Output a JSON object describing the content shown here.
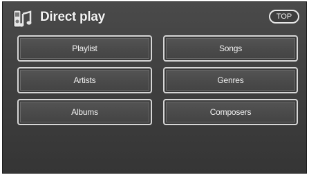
{
  "header": {
    "title": "Direct play",
    "icon": "music-note-icon",
    "top_label": "TOP"
  },
  "buttons": [
    {
      "label": "Playlist"
    },
    {
      "label": "Songs"
    },
    {
      "label": "Artists"
    },
    {
      "label": "Genres"
    },
    {
      "label": "Albums"
    },
    {
      "label": "Composers"
    }
  ],
  "colors": {
    "background": "#404040",
    "button_border": "#d6d6d6",
    "text": "#f2f2f2"
  }
}
